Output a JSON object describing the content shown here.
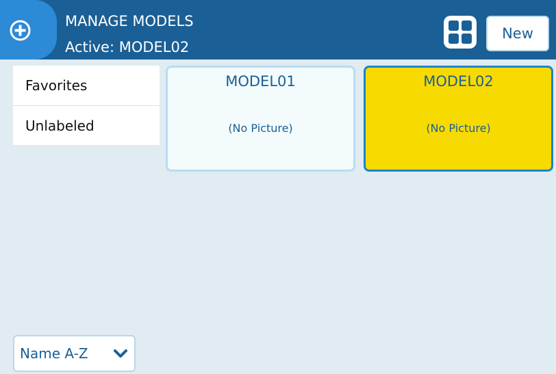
{
  "header": {
    "title": "MANAGE MODELS",
    "subtitle": "Active: MODEL02",
    "logo_icon": "plus-circle-icon",
    "view_toggle_icon": "grid-icon",
    "new_label": "New"
  },
  "sidebar": {
    "items": [
      {
        "label": "Favorites"
      },
      {
        "label": "Unlabeled"
      }
    ]
  },
  "models": [
    {
      "name": "MODEL01",
      "picture": "(No Picture)",
      "selected": false
    },
    {
      "name": "MODEL02",
      "picture": "(No Picture)",
      "selected": true
    }
  ],
  "sort": {
    "selected": "Name A-Z",
    "icon": "chevron-down-icon"
  },
  "colors": {
    "header_bg": "#1A5F96",
    "accent_tab": "#2C8AD6",
    "background": "#E1EBF2",
    "selected_card": "#F7DA00",
    "card_bg": "#F3FBFC"
  }
}
